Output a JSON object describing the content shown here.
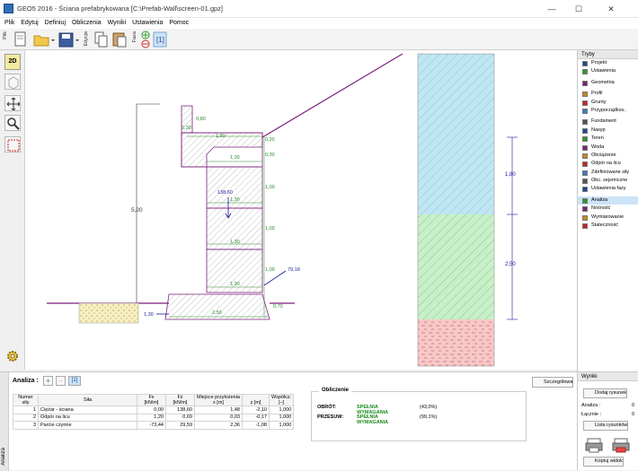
{
  "window": {
    "title": "GEO5 2016 - Ściana prefabrykowana [C:\\Prefab-Wall\\screen-01.gpz]",
    "min": "—",
    "max": "☐",
    "close": "✕"
  },
  "menu": [
    "Plik",
    "Edytuj",
    "Definiuj",
    "Obliczenia",
    "Wyniki",
    "Ustawienia",
    "Pomoc"
  ],
  "toolbar": {
    "group1": "Plik",
    "group2": "Edycja",
    "group3": "Faza"
  },
  "left_tools": {
    "view2d": "2D"
  },
  "drawing": {
    "dim_height": "5,20",
    "dim_top": "0,80",
    "dim_cap": "0,30",
    "dim_cap_width": "1,90",
    "dim_h1": "0,20",
    "dim_h2": "0,30",
    "dim_w1": "1,30",
    "dim_h3": "1,00",
    "dim_h4": "1,00",
    "dim_h5": "1,00",
    "dim_h6": "1,00",
    "dim_w2": "1,30",
    "dim_w3": "1,30",
    "dim_w4": "1,30",
    "force_label": "138,60",
    "dim_base_h": "0,70",
    "dim_base_w": "2,50",
    "dim_toe": "1,30",
    "pressure_label": "79,18",
    "profile_h1": "1,80",
    "profile_h2": "2,50"
  },
  "right_panel": {
    "header": "Tryby",
    "groups": [
      [
        "Projekt",
        "Ustawienia"
      ],
      [
        "Geometria"
      ],
      [
        "Profil",
        "Grunty",
        "Przyporządkov.."
      ],
      [
        "Fundament",
        "Nasyp",
        "Teren",
        "Woda",
        "Obciążenie",
        "Odpór na licu",
        "Zdefiniowane siły",
        "Obc. sejsmiczne",
        "Ustawienia fazy"
      ],
      [
        "Analiza",
        "Nośność",
        "Wymiarowanie",
        "Stateczność"
      ]
    ],
    "active": "Analiza"
  },
  "analysis": {
    "header": "Analiza :",
    "sidelabel": "Analiza",
    "details_button": "Szczegółowa",
    "columns": [
      "Numer siły",
      "Siła",
      "Fx [kN/m]",
      "Fz [kN/m]",
      "Miejsce przyłożenia x [m]",
      "z [m]",
      "Współcz. [–]"
    ],
    "col_head": {
      "num": "Numer",
      "num2": "siły",
      "force": "Siła",
      "fx": "Fx",
      "fz": "Fz",
      "unit": "[kN/m]",
      "place": "Miejsce przyłożenia",
      "x": "x [m]",
      "z": "z [m]",
      "coef": "Współcz.",
      "coef_unit": "[–]"
    },
    "rows": [
      {
        "n": "1",
        "name": "Ciężar - ściana",
        "fx": "0,00",
        "fz": "138,60",
        "x": "1,48",
        "z": "-2,10",
        "k": "1,000"
      },
      {
        "n": "2",
        "name": "Odpór na licu",
        "fx": "1,20",
        "fz": "0,69",
        "x": "0,03",
        "z": "-0,17",
        "k": "1,000"
      },
      {
        "n": "3",
        "name": "Parcie czynne",
        "fx": "-73,44",
        "fz": "29,59",
        "x": "2,36",
        "z": "-1,08",
        "k": "1,000"
      }
    ]
  },
  "calculation": {
    "legend": "Obliczenie",
    "rows": [
      {
        "label": "OBRÓT:",
        "status": "SPEŁNIA WYMAGANIA",
        "pct": "(43,0%)"
      },
      {
        "label": "PRZESUW:",
        "status": "SPEŁNIA WYMAGANIA",
        "pct": "(99,1%)"
      }
    ]
  },
  "results": {
    "header": "Wyniki",
    "add_drawing": "Dodaj rysunek",
    "analiza_label": "Analiza :",
    "analiza_val": "0",
    "total_label": "Łącznie :",
    "total_val": "0",
    "list_drawings": "Lista rysunków",
    "copy_view": "Kopiuj widok"
  },
  "colors": {
    "wall": "#7b1f7b",
    "soil1": "#bfe6f2",
    "soil2": "#c8f0c8",
    "soil3": "#f7c8c8",
    "dims_green": "#2d8a2d",
    "dims_blue": "#1a1a9a"
  }
}
